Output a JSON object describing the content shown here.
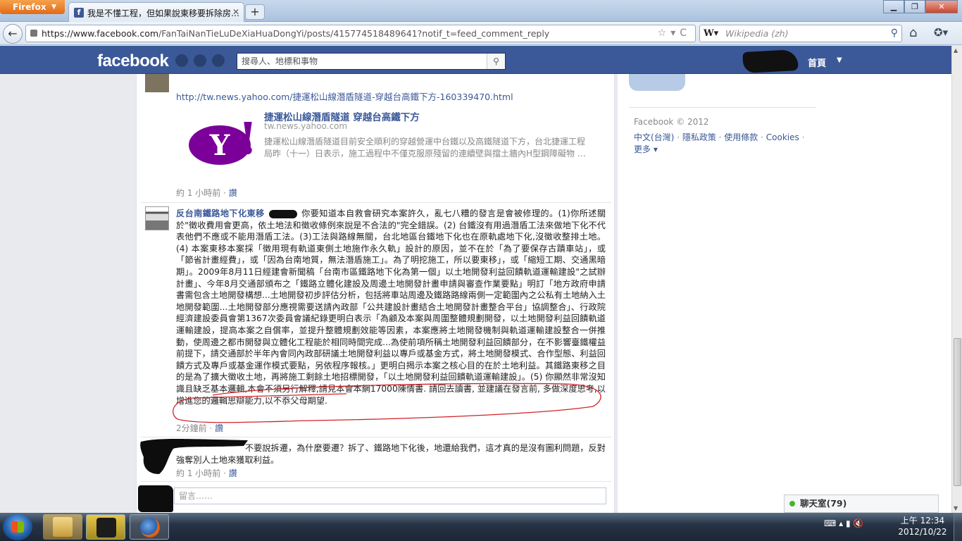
{
  "browser": {
    "menu_button": "Firefox",
    "tab_title": "我是不懂工程，但如果說東移要拆除房…",
    "url_host": "https://www.facebook.com",
    "url_path": "/FanTaiNanTieLuDeXiaHuaDongYi/posts/415774518489641?notif_t=feed_comment_reply",
    "search_placeholder": "Wikipedia (zh)"
  },
  "facebook": {
    "logo": "facebook",
    "search_placeholder": "搜尋人、地標和事物",
    "home_label": "首頁"
  },
  "comments": [
    {
      "shared_url": "http://tw.news.yahoo.com/捷運松山線潛盾隧道-穿越台高鐵下方-160339470.html",
      "preview_title": "捷運松山線潛盾隧道 穿越台高鐵下方",
      "preview_domain": "tw.news.yahoo.com",
      "preview_desc": "捷運松山線潛盾隧道目前安全順利的穿越營運中台鐵以及高鐵隧道下方，台北捷運工程局昨（十一）日表示，施工過程中不僅克服原殘留的連續壁與擋土牆內H型鋼障礙物 …",
      "time": "約 1 小時前",
      "like": "讚"
    },
    {
      "author": "反台南鐵路地下化東移",
      "body": "你要知道本自救會研究本案許久，亂七八糟的發言是會被修理的。(1)你所述關於\"徵收費用會更高，依土地法和徵收條例來說是不合法的\"完全錯誤。(2) 台鐵沒有用過潛盾工法來做地下化不代表他們不應或不能用潛盾工法。(3)工法與路線無關，台北地區台鐵地下化也在原軌處地下化,沒徵收整排土地。(4) 本案東移本案採「徵用現有軌道東側土地施作永久軌」設計的原因，並不在於「為了要保存古蹟車站」，或「節省計畫經費」，或「因為台南地質，無法潛盾施工」。為了明挖施工，所以要東移」，或「縮短工期、交通黑暗期」。2009年8月11日經建會新聞稿「台南市區鐵路地下化為第一個」以土地開發利益回饋軌道運輸建設\"之試辦計畫」、今年8月交通部頒布之「鐵路立體化建設及周邊土地開發計畫申請與審查作業要點」明訂「地方政府申請書需包含土地開發構想...土地開發初步評估分析，包括將車站周邊及鐵路路線兩側一定範圍內之公私有土地納入土地開發範圍...土地開發部分應視需要送請內政部「公共建設計畫結合土地開發計畫整合平台」協調整合」、行政院經濟建設委員會第1367次委員會議紀錄更明白表示「為顧及本案與周圍整體規劃開發，以土地開發利益回饋軌道運輸建設，提高本案之自償率，並提升整體規劃效能等因素，本案應將土地開發機制與軌道運輸建設整合一併推動，使周邊之都市開發與立體化工程能於相同時間完成...為使前項所稱土地開發利益回饋部分，在不影響臺鐵權益前提下，請交通部於半年內會同內政部研議土地開發利益以專戶或基金方式，將土地開發模式、合作型態、利益回饋方式及專戶或基金運作模式要點，另依程序報核。」更明白揭示本案之核心目的在於土地利益。其鐵路東移之目的是為了擴大徵收土地，再將施工剩餘土地招標開發，「以土地開發利益回饋軌道運輸建設」。(5) 你顯然非常沒知識且缺乏基本邏輯,本會不須另行解釋,請見本會本網17000陳情書. 請回去讀書, 並建議在發言前, 多做深度思考,以增進您的邏輯思辯能力,以不忝父母期望.",
      "time": "2分鐘前",
      "like": "讚"
    },
    {
      "body": "不要說拆遷，為什麼要遷？拆了、鐵路地下化後，地還給我們，這才真的是沒有圖利問題，反對強奪別人土地來獲取利益。",
      "time": "約 1 小時前",
      "like": "讚"
    }
  ],
  "composer_placeholder": "留言……",
  "sidebar": {
    "copyright": "Facebook © 2012",
    "links": [
      "中文(台灣)",
      "隱私政策",
      "使用條款",
      "Cookies"
    ],
    "more": "更多"
  },
  "chat": {
    "label": "聊天室",
    "count": "(79)"
  },
  "taskbar": {
    "time": "上午 12:34",
    "date": "2012/10/22"
  },
  "colors": {
    "facebook_blue": "#3b5998",
    "link": "#3b5998",
    "annotation_red": "#d2232a"
  }
}
